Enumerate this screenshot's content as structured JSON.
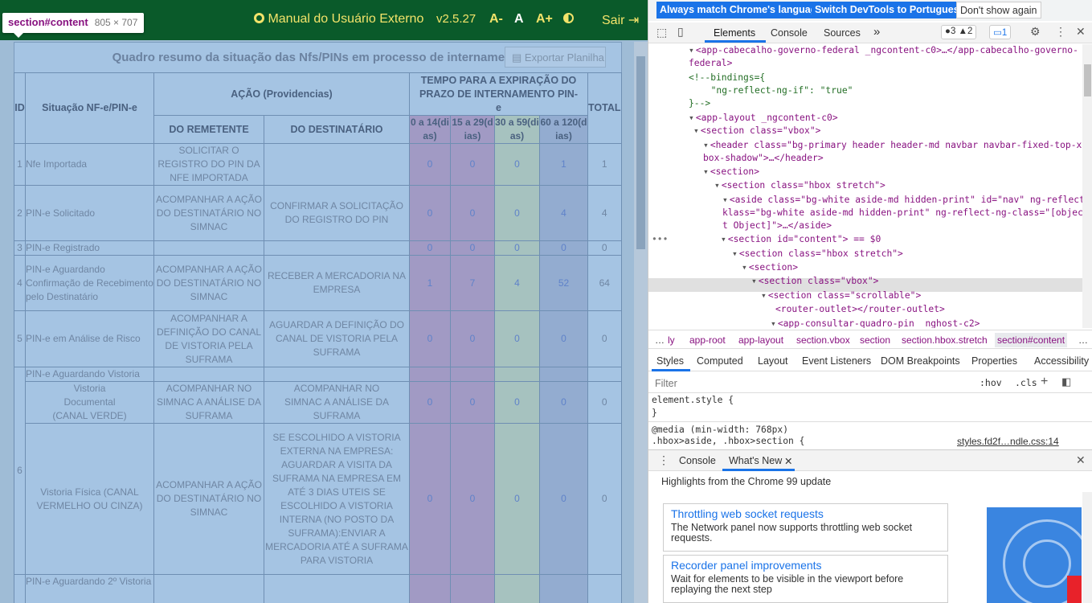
{
  "app": {
    "header": {
      "manual_icon": "circle-icon",
      "manual_label": "Manual do Usuário Externo",
      "version": "v2.5.27",
      "font_decrease": "A-",
      "font_normal": "A",
      "font_increase": "A+",
      "contrast_icon": "contrast-icon",
      "exit_label": "Sair"
    },
    "inspector_tooltip": {
      "selector_tag": "section",
      "selector_id": "#content",
      "size": "805 × 707"
    },
    "panel": {
      "title": "Quadro resumo da situação das Nfs/PINs em processo de internamento",
      "export_label": "Exportar Planilha"
    },
    "table": {
      "headers": {
        "id": "ID",
        "situacao": "Situação NF-e/PIN-e",
        "acao": "AÇÃO (Providencias)",
        "tempo": "TEMPO PARA A EXPIRAÇÃO DO PRAZO DE INTERNAMENTO PIN-e",
        "total": "TOTAL",
        "remetente": "DO REMETENTE",
        "destinatario": "DO DESTINATÁRIO",
        "r1": "0 a 14(dias)",
        "r2": "15 a 29(dias)",
        "r3": "30 a 59(dias)",
        "r4": "60 a 120(dias)"
      },
      "rows": [
        {
          "id": "1",
          "situacao": "Nfe Importada",
          "remetente": "SOLICITAR O REGISTRO DO PIN DA NFE IMPORTADA",
          "destinatario": "",
          "v": [
            "0",
            "0",
            "0",
            "1"
          ],
          "total": "1"
        },
        {
          "id": "2",
          "situacao": "PIN-e Solicitado",
          "remetente": "ACOMPANHAR A AÇÃO DO DESTINATÁRIO NO SIMNAC",
          "destinatario": "CONFIRMAR A SOLICITAÇÃO DO REGISTRO DO PIN",
          "v": [
            "0",
            "0",
            "0",
            "4"
          ],
          "total": "4"
        },
        {
          "id": "3",
          "situacao": "PIN-e Registrado",
          "remetente": "",
          "destinatario": "",
          "v": [
            "0",
            "0",
            "0",
            "0"
          ],
          "total": "0"
        },
        {
          "id": "4",
          "situacao": "PIN-e Aguardando Confirmação de Recebimento pelo Destinatário",
          "remetente": "ACOMPANHAR A AÇÃO DO DESTINATÁRIO NO SIMNAC",
          "destinatario": "RECEBER A MERCADORIA NA EMPRESA",
          "v": [
            "1",
            "7",
            "4",
            "52"
          ],
          "total": "64"
        },
        {
          "id": "5",
          "situacao": "PIN-e em Análise de Risco",
          "remetente": "ACOMPANHAR A DEFINIÇÃO DO CANAL DE VISTORIA PELA SUFRAMA",
          "destinatario": "AGUARDAR A DEFINIÇÃO DO CANAL DE VISTORIA PELA SUFRAMA",
          "v": [
            "0",
            "0",
            "0",
            "0"
          ],
          "total": "0"
        }
      ],
      "row6": {
        "id": "6",
        "situacao": "PIN-e Aguardando Vistoria",
        "doc": {
          "situacao": "Vistoria Documental (CANAL VERDE)",
          "remetente": "ACOMPANHAR NO SIMNAC A ANÁLISE DA SUFRAMA",
          "destinatario": "ACOMPANHAR NO SIMNAC A ANÁLISE DA SUFRAMA",
          "v": [
            "0",
            "0",
            "0",
            "0"
          ],
          "total": "0"
        },
        "fis": {
          "situacao": "Vistoria Física (CANAL VERMELHO OU CINZA)",
          "remetente": "ACOMPANHAR A AÇÃO DO DESTINATÁRIO NO SIMNAC",
          "destinatario": "SE ESCOLHIDO A VISTORIA EXTERNA NA EMPRESA: AGUARDAR A VISITA DA SUFRAMA NA EMPRESA EM ATÉ 3 DIAS UTEIS SE ESCOLHIDO A VISTORIA INTERNA (NO POSTO DA SUFRAMA):ENVIAR A MERCADORIA ATÉ A SUFRAMA PARA VISTORIA",
          "v": [
            "0",
            "0",
            "0",
            "0"
          ],
          "total": "0"
        }
      },
      "row7_situacao": "PIN-e Aguardando 2º Vistoria"
    }
  },
  "devtools": {
    "lang": {
      "match": "Always match Chrome's language",
      "switch": "Switch DevTools to Portuguese",
      "dismiss": "Don't show again"
    },
    "tabs": [
      "Elements",
      "Console",
      "Sources"
    ],
    "more_tabs": "»",
    "issues": {
      "errors": "3",
      "warnings": "2",
      "messages": "1"
    },
    "dom_lines": [
      "<app-cabecalho-governo-federal _ngcontent-c0>…</app-cabecalho-governo-",
      "federal>",
      "<!--bindings={",
      "  \"ng-reflect-ng-if\": \"true\"",
      "}-->",
      "<app-layout _ngcontent-c0>",
      "<section class=\"vbox\">",
      "<header class=\"bg-primary header header-md navbar navbar-fixed-top-xs",
      "box-shadow\">…</header>",
      "<section>",
      "<section class=\"hbox stretch\">",
      "<aside class=\"bg-white aside-md hidden-print\" id=\"nav\" ng-reflect-",
      "klass=\"bg-white aside-md hidden-print\" ng-reflect-ng-class=\"[objec",
      "t Object]\">…</aside>",
      "<section id=\"content\"> == $0",
      "<section class=\"hbox stretch\">",
      "<section>",
      "<section class=\"vbox\">",
      "<section class=\"scrollable\">",
      "<router-outlet></router-outlet>",
      "<app-consultar-quadro-pin _nghost-c2>"
    ],
    "breadcrumbs": [
      "…",
      "ly",
      "app-root",
      "app-layout",
      "section.vbox",
      "section",
      "section.hbox.stretch",
      "section#content",
      "…"
    ],
    "sub_tabs": [
      "Styles",
      "Computed",
      "Layout",
      "Event Listeners",
      "DOM Breakpoints",
      "Properties",
      "Accessibility"
    ],
    "filter_placeholder": "Filter",
    "hov": ":hov",
    "cls": ".cls",
    "css": {
      "element_style": "element.style {",
      "close": "}",
      "media": "@media (min-width: 768px)",
      "rule": ".hbox>aside, .hbox>section {",
      "source": "styles.fd2f…ndle.css:14"
    },
    "drawer": {
      "console": "Console",
      "whats_new": "What's New",
      "highlights": "Highlights from the Chrome 99 update"
    },
    "cards": [
      {
        "title": "Throttling web socket requests",
        "desc": "The Network panel now supports throttling web socket requests."
      },
      {
        "title": "Recorder panel improvements",
        "desc": "Wait for elements to be visible in the viewport before replaying the next step"
      }
    ]
  }
}
